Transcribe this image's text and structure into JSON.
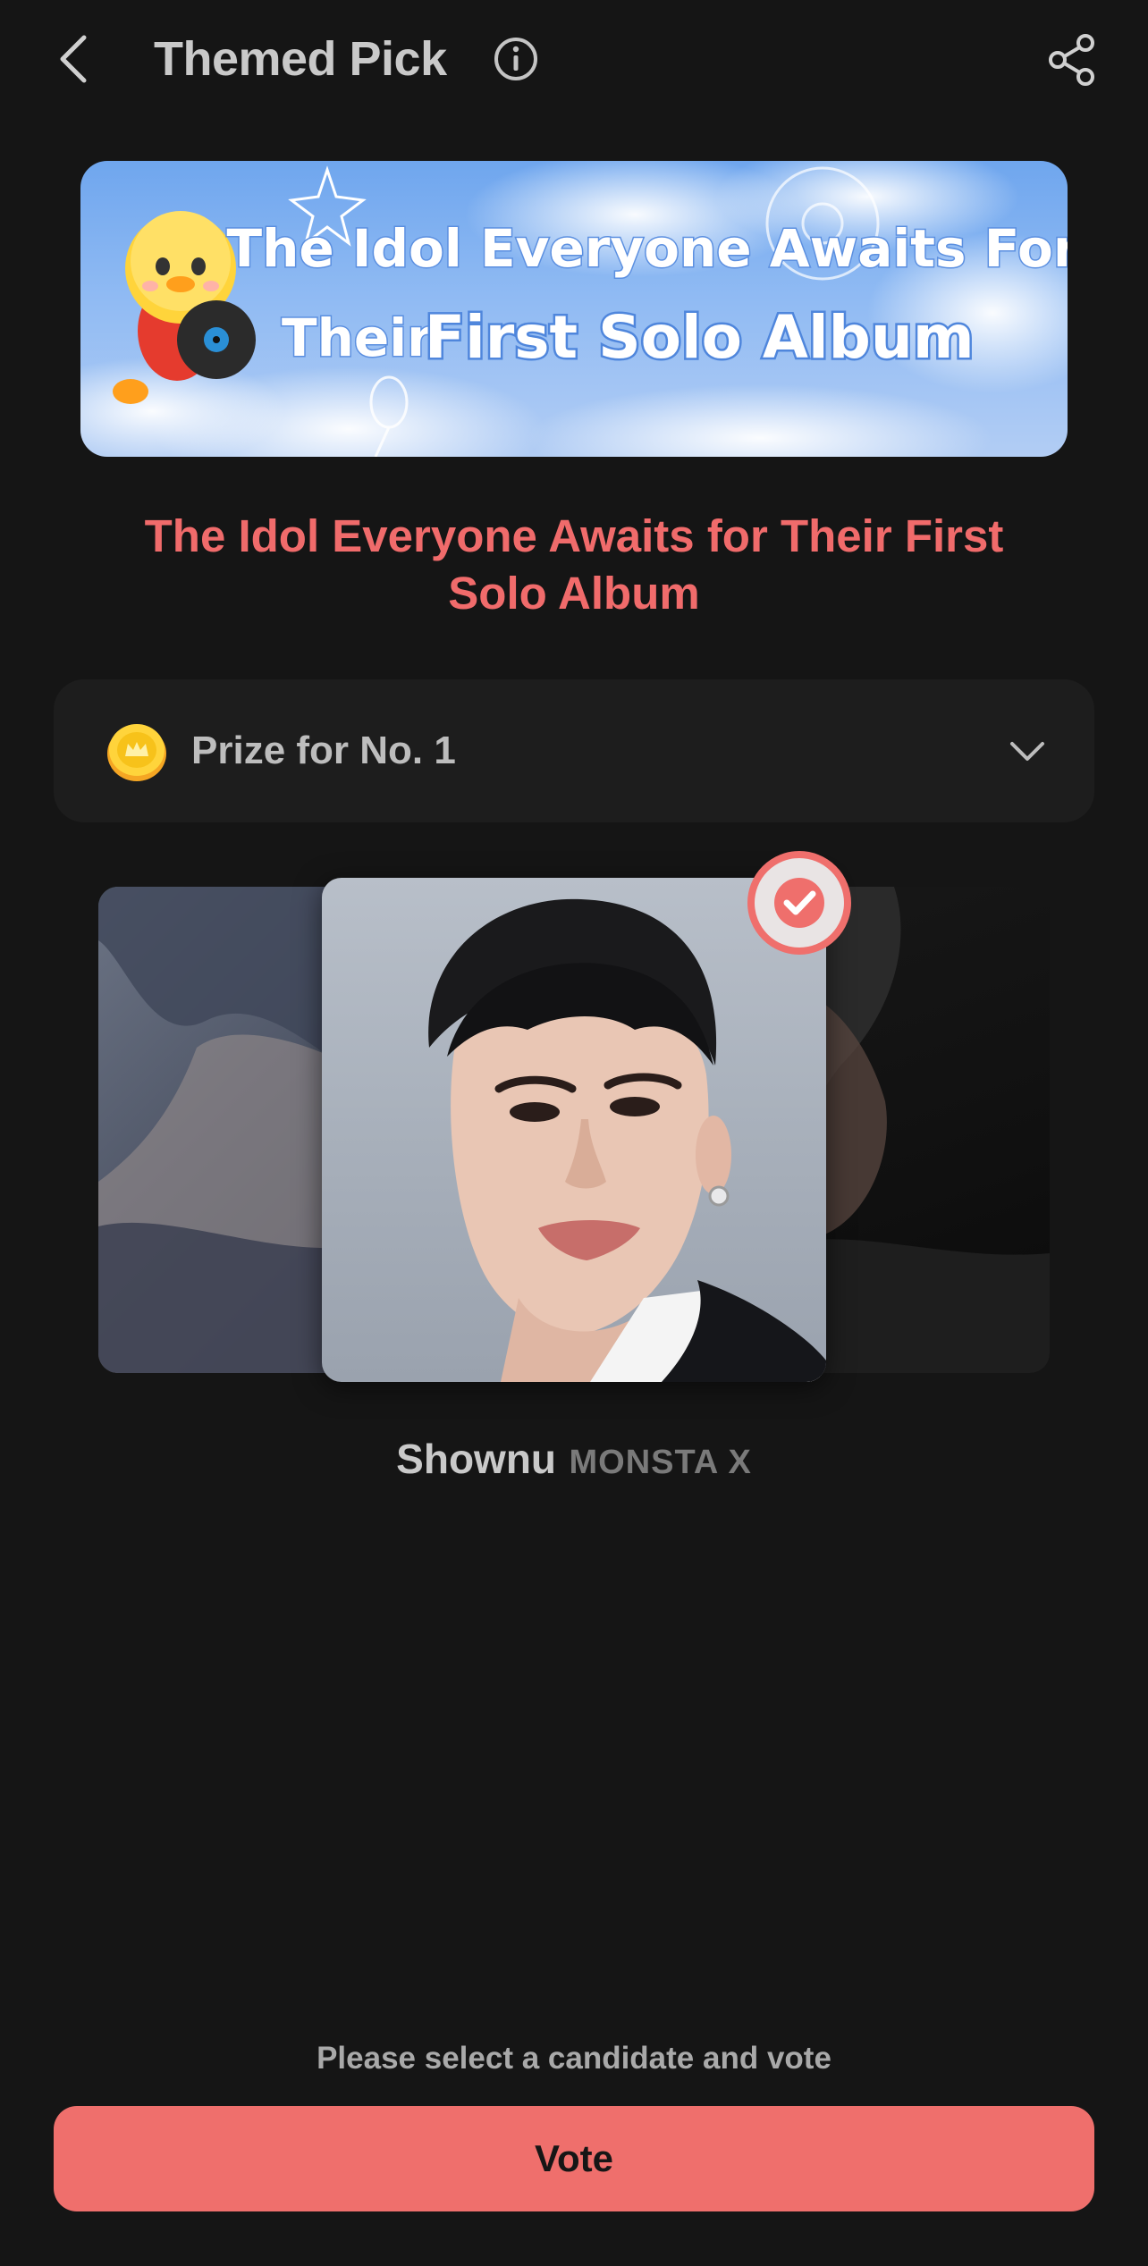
{
  "header": {
    "title": "Themed Pick",
    "back_icon": "chevron-left-icon",
    "info_icon": "info-icon",
    "share_icon": "share-icon"
  },
  "banner": {
    "line1": "The Idol Everyone Awaits For",
    "line2_prefix": "Their",
    "line2_emphasis": "First Solo Album"
  },
  "pick": {
    "heading_line1": "The Idol Everyone Awaits for Their First",
    "heading_line2": "Solo Album"
  },
  "prize": {
    "label": "Prize for No. 1",
    "icon": "coin-icon",
    "toggle_icon": "chevron-down-icon"
  },
  "selected_candidate": {
    "name": "Shownu",
    "group": "MONSTA X",
    "selected": true,
    "badge_icon": "check-icon"
  },
  "footer": {
    "hint": "Please select a candidate and vote",
    "vote_label": "Vote"
  },
  "colors": {
    "background": "#151515",
    "accent": "#ef6f6c",
    "heading": "#f06b6b",
    "panel": "#1d1d1d"
  }
}
